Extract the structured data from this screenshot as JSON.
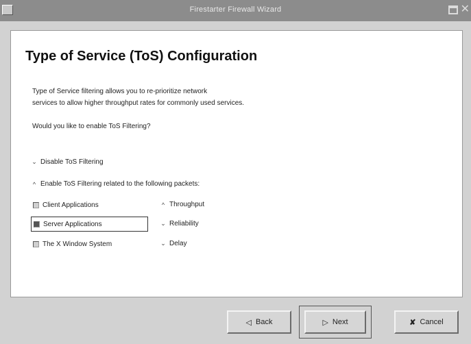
{
  "window": {
    "title": "Firestarter Firewall Wizard"
  },
  "page": {
    "heading": "Type of Service (ToS) Configuration",
    "description_line1": "Type of Service filtering allows you to re-prioritize network",
    "description_line2": "services to allow higher throughput rates for commonly used services.",
    "question": "Would you like to enable ToS Filtering?"
  },
  "tos_mode": {
    "disable_label": "Disable ToS Filtering",
    "enable_label": "Enable ToS Filtering related to the following packets:",
    "selected": "enable"
  },
  "packet_types": [
    {
      "label": "Client Applications",
      "checked": false
    },
    {
      "label": "Server Applications",
      "checked": true
    },
    {
      "label": "The X Window System",
      "checked": false
    }
  ],
  "priority": {
    "options": [
      "Throughput",
      "Reliability",
      "Delay"
    ],
    "selected": "Throughput"
  },
  "buttons": {
    "back_label": "Back",
    "next_label": "Next",
    "cancel_label": "Cancel"
  },
  "icons": {
    "back": "back-arrow-icon",
    "next": "next-arrow-icon",
    "cancel": "cancel-x-icon"
  }
}
